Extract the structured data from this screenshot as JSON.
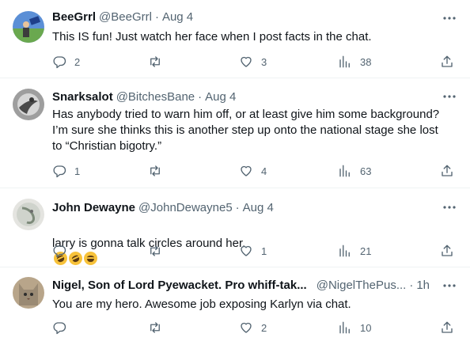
{
  "tweets": [
    {
      "name": "BeeGrrl",
      "handle": "@BeeGrrl",
      "separator": "·",
      "time": "Aug 4",
      "text": "This IS fun! Just watch her face when I post facts in the chat.",
      "replies": "2",
      "retweets": "",
      "likes": "3",
      "views": "38"
    },
    {
      "name": "Snarksalot",
      "handle": "@BitchesBane",
      "separator": "·",
      "time": "Aug 4",
      "text": "Has anybody tried to warn him off, or at least give him some background?\nI’m sure she thinks this is another step up onto the national stage she lost\nto “Christian bigotry.”",
      "replies": "1",
      "retweets": "",
      "likes": "4",
      "views": "63"
    },
    {
      "name": "John Dewayne",
      "handle": "@JohnDewayne5",
      "separator": "·",
      "time": "Aug 4",
      "text": "larry is gonna talk circles around her.",
      "emoji": [
        "rolling-on-floor-laughing",
        "rolling-on-floor-laughing",
        "grinning-squinting-face"
      ],
      "replies": "",
      "retweets": "",
      "likes": "1",
      "views": "21"
    },
    {
      "name": "Nigel, Son of Lord Pyewacket. Pro whiff-tak...",
      "handle": "@NigelThePus...",
      "separator": "·",
      "time": "1h",
      "text": "You are my hero.  Awesome job exposing Karlyn via chat.",
      "replies": "",
      "retweets": "",
      "likes": "2",
      "views": "10"
    }
  ],
  "icons": {
    "more": "more-dots-icon",
    "reply": "reply-icon",
    "retweet": "retweet-icon",
    "like": "heart-icon",
    "views": "views-chart-icon",
    "share": "share-icon"
  },
  "colors": {
    "text": "#0f1419",
    "secondary": "#536471",
    "divider": "#eff3f4"
  }
}
